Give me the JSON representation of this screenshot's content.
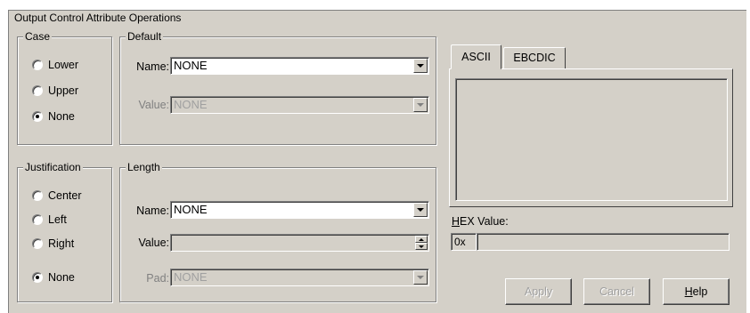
{
  "dialog_title": "Output Control Attribute Operations",
  "case": {
    "label": "Case",
    "options": [
      "Lower",
      "Upper",
      "None"
    ],
    "selected": "None"
  },
  "justification": {
    "label": "Justification",
    "options": [
      "Center",
      "Left",
      "Right",
      "None"
    ],
    "selected": "None"
  },
  "default": {
    "label": "Default",
    "name_label": "Name:",
    "name_value": "NONE",
    "value_label": "Value:",
    "value_value": "NONE"
  },
  "length": {
    "label": "Length",
    "name_label": "Name:",
    "name_value": "NONE",
    "value_label": "Value:",
    "value_value": "",
    "pad_label": "Pad:",
    "pad_value": "NONE"
  },
  "tabs": {
    "ascii": "ASCII",
    "ebcdic": "EBCDIC",
    "active": "ASCII"
  },
  "hex": {
    "label_first": "H",
    "label_rest": "EX Value:",
    "prefix": "0x",
    "value": ""
  },
  "buttons": {
    "apply": "Apply",
    "cancel": "Cancel",
    "help_first": "H",
    "help_rest": "elp"
  }
}
